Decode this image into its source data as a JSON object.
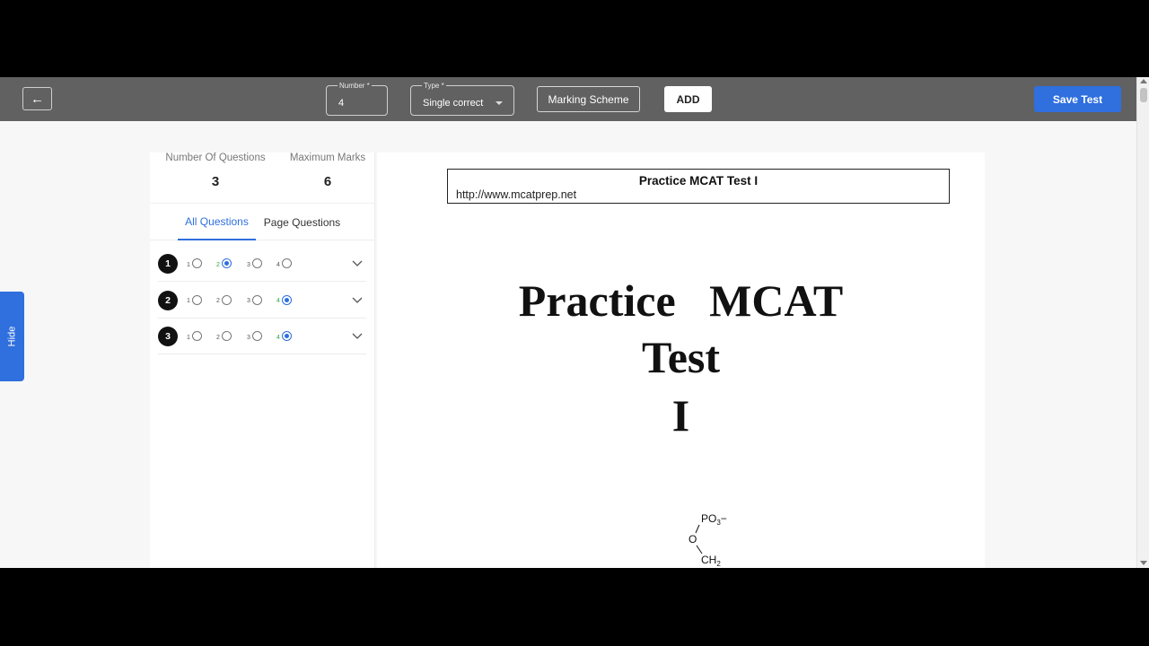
{
  "toolbar": {
    "back_icon": "arrow-left-icon",
    "number_label": "Number *",
    "number_value": "4",
    "type_label": "Type *",
    "type_value": "Single correct",
    "marking_scheme_label": "Marking Scheme",
    "add_label": "ADD",
    "save_label": "Save Test",
    "save_color": "#2f6fde"
  },
  "side_tab": {
    "label": "Hide"
  },
  "panel": {
    "stats": [
      {
        "label": "Number Of Questions",
        "value": "3"
      },
      {
        "label": "Maximum Marks",
        "value": "6"
      }
    ],
    "tabs": [
      {
        "label": "All Questions",
        "active": true
      },
      {
        "label": "Page Questions",
        "active": false
      }
    ],
    "questions": [
      {
        "number": "1",
        "options": [
          "1",
          "2",
          "3",
          "4"
        ],
        "selected": 2
      },
      {
        "number": "2",
        "options": [
          "1",
          "2",
          "3",
          "4"
        ],
        "selected": 4
      },
      {
        "number": "3",
        "options": [
          "1",
          "2",
          "3",
          "4"
        ],
        "selected": 4
      }
    ]
  },
  "document": {
    "header_title": "Practice MCAT Test I",
    "header_url": "http://www.mcatprep.net",
    "title_lines": [
      "Practice   MCAT",
      "Test",
      "I"
    ],
    "molecule": {
      "top": "PO",
      "top_sub": "3",
      "top_suffix": "−",
      "mid": "O",
      "bottom": "CH",
      "bottom_sub": "2"
    }
  }
}
